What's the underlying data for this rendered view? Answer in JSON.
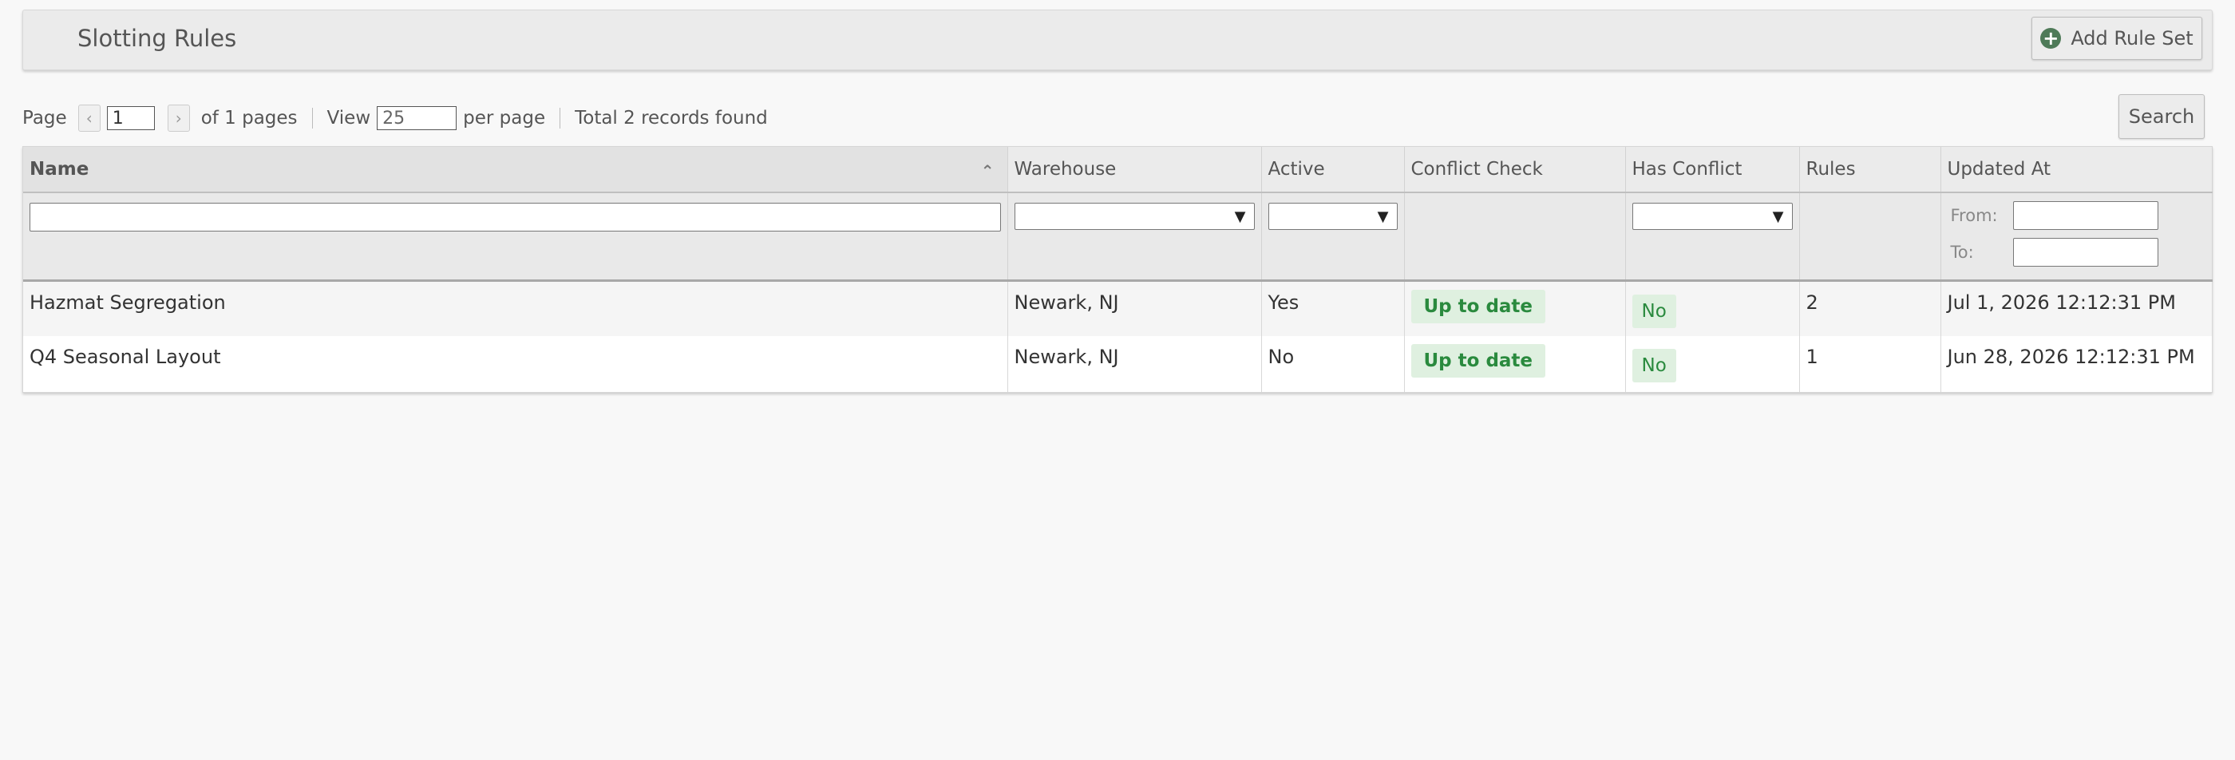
{
  "header": {
    "title": "Slotting Rules",
    "add_button_label": "Add Rule Set"
  },
  "pager": {
    "page_label": "Page",
    "current_page": "1",
    "of_pages": "of 1 pages",
    "view_label": "View",
    "per_page_value": "25",
    "per_page_label": "per page",
    "total_label": "Total 2 records found",
    "search_label": "Search"
  },
  "table": {
    "columns": [
      "Name",
      "Warehouse",
      "Active",
      "Conflict Check",
      "Has Conflict",
      "Rules",
      "Updated At"
    ],
    "date_filter": {
      "from_label": "From:",
      "to_label": "To:"
    },
    "rows": [
      {
        "name": "Hazmat Segregation",
        "warehouse": "Newark, NJ",
        "active": "Yes",
        "conflict_check": "Up to date",
        "has_conflict": "No",
        "rules": "2",
        "updated_at": "Jul 1, 2026 12:12:31 PM"
      },
      {
        "name": "Q4 Seasonal Layout",
        "warehouse": "Newark, NJ",
        "active": "No",
        "conflict_check": "Up to date",
        "has_conflict": "No",
        "rules": "1",
        "updated_at": "Jun 28, 2026 12:12:31 PM"
      }
    ]
  },
  "icons": {
    "add": "plus-circle-icon",
    "sort": "sort-ascending-icon",
    "prev": "chevron-left-icon",
    "next": "chevron-right-icon",
    "select": "chevron-down-icon"
  },
  "colors": {
    "badge_bg": "#dff0e0",
    "badge_text": "#2a8a3e",
    "add_icon": "#4e7a58"
  }
}
